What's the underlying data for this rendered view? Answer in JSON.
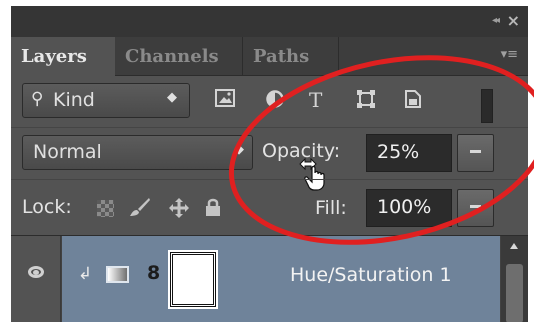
{
  "window": {
    "collapse_label": "◂◂",
    "close_label": "×"
  },
  "tabs": [
    {
      "label": "Layers",
      "active": true
    },
    {
      "label": "Channels",
      "active": false
    },
    {
      "label": "Paths",
      "active": false
    }
  ],
  "panel_menu_icon": "≡",
  "filter": {
    "kind_icon": "search-icon",
    "kind_label": "Kind",
    "kind_arrow": "◆",
    "buttons": [
      "pixel-layer-filter-icon",
      "adjustment-layer-filter-icon",
      "type-layer-filter-icon",
      "shape-layer-filter-icon",
      "smart-object-filter-icon"
    ],
    "type_glyph": "T"
  },
  "blend": {
    "mode_label": "Normal",
    "mode_arrow": "◆",
    "opacity_label": "Opacity:",
    "opacity_value": "25%"
  },
  "lock": {
    "label": "Lock:",
    "icons": [
      "lock-transparent-pixels-icon",
      "lock-image-pixels-icon",
      "lock-position-icon",
      "lock-all-icon"
    ],
    "fill_label": "Fill:",
    "fill_value": "100%"
  },
  "layers": [
    {
      "name": "Hue/Saturation 1",
      "visible": true,
      "clipped": true,
      "type": "adjustment",
      "selected": true
    }
  ],
  "colors": {
    "panel": "#535353",
    "selected_layer": "#6f839a",
    "highlight": "#e02020"
  }
}
